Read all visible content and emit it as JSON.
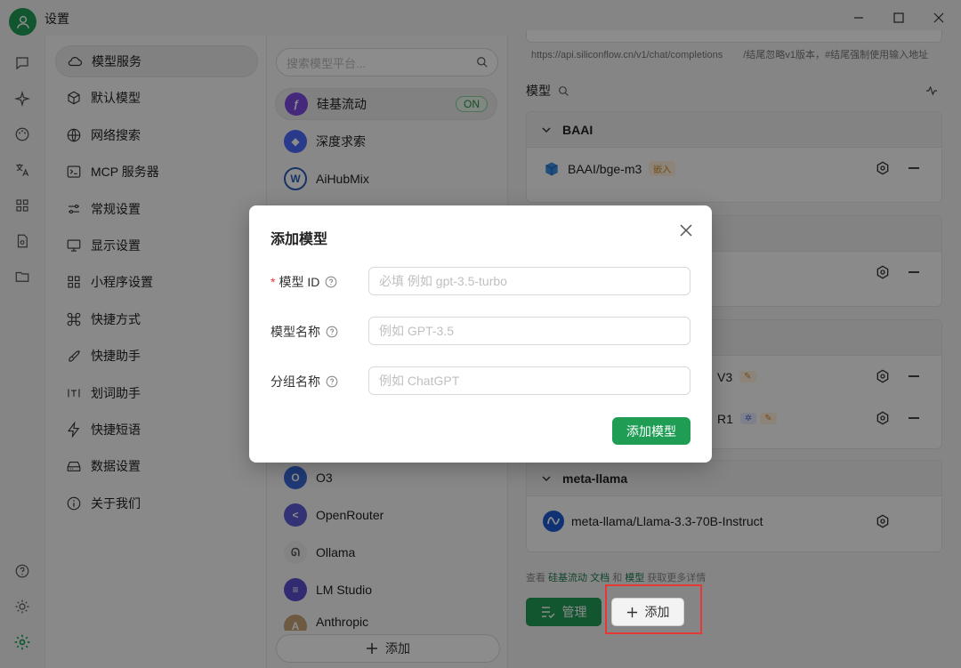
{
  "window": {
    "title": "设置"
  },
  "settings_nav": [
    {
      "label": "模型服务",
      "icon": "cloud-icon",
      "active": true
    },
    {
      "label": "默认模型",
      "icon": "cube-icon"
    },
    {
      "label": "网络搜索",
      "icon": "globe-icon"
    },
    {
      "label": "MCP 服务器",
      "icon": "terminal-icon"
    },
    {
      "label": "常规设置",
      "icon": "settings-icon"
    },
    {
      "label": "显示设置",
      "icon": "monitor-icon"
    },
    {
      "label": "小程序设置",
      "icon": "grid-icon"
    },
    {
      "label": "快捷方式",
      "icon": "command-icon"
    },
    {
      "label": "快捷助手",
      "icon": "rocket-icon"
    },
    {
      "label": "划词助手",
      "icon": "text-select-icon"
    },
    {
      "label": "快捷短语",
      "icon": "zap-icon"
    },
    {
      "label": "数据设置",
      "icon": "hard-drive-icon"
    },
    {
      "label": "关于我们",
      "icon": "info-icon"
    }
  ],
  "providers": {
    "search_placeholder": "搜索模型平台...",
    "items": [
      {
        "name": "硅基流动",
        "badge": "ON",
        "active": true,
        "color": "#7b4ae2"
      },
      {
        "name": "深度求索",
        "color": "#4d6bfe"
      },
      {
        "name": "AiHubMix",
        "color": "#2b5fb8"
      },
      {
        "name": "O3",
        "color": "#3a6bd8"
      },
      {
        "name": "OpenRouter",
        "color": "#5b5bd6"
      },
      {
        "name": "Ollama",
        "color": "#bbbbbb"
      },
      {
        "name": "LM Studio",
        "color": "#5a4fcf"
      },
      {
        "name": "Anthropic",
        "color": "#c9a27a"
      }
    ],
    "add_label": "添加"
  },
  "main": {
    "url_text": "https://api.siliconflow.cn/v1/chat/completions",
    "url_hint": "/结尾忽略v1版本，#结尾强制使用输入地址",
    "models_label": "模型",
    "groups": [
      {
        "name": "BAAI",
        "models": [
          {
            "name": "BAAI/bge-m3",
            "tag": "嵌入"
          }
        ]
      },
      {
        "name": "",
        "models": [
          {
            "name": "",
            "tag": ""
          }
        ]
      },
      {
        "name": "",
        "models": [
          {
            "name": "V3",
            "tag": ""
          },
          {
            "name": "R1",
            "tag": ""
          }
        ]
      },
      {
        "name": "meta-llama",
        "models": [
          {
            "name": "meta-llama/Llama-3.3-70B-Instruct",
            "tag": ""
          }
        ]
      }
    ],
    "footnote": {
      "prefix": "查看",
      "link1": "硅基流动 文档",
      "mid": "和",
      "link2": "模型",
      "suffix": "获取更多详情"
    },
    "manage_label": "管理",
    "add_label": "添加"
  },
  "modal": {
    "title": "添加模型",
    "fields": [
      {
        "label": "模型 ID",
        "required": true,
        "placeholder": "必填 例如 gpt-3.5-turbo"
      },
      {
        "label": "模型名称",
        "required": false,
        "placeholder": "例如 GPT-3.5"
      },
      {
        "label": "分组名称",
        "required": false,
        "placeholder": "例如 ChatGPT"
      }
    ],
    "submit_label": "添加模型"
  },
  "colors": {
    "accent": "#1f9d55",
    "highlight": "#e53935"
  }
}
